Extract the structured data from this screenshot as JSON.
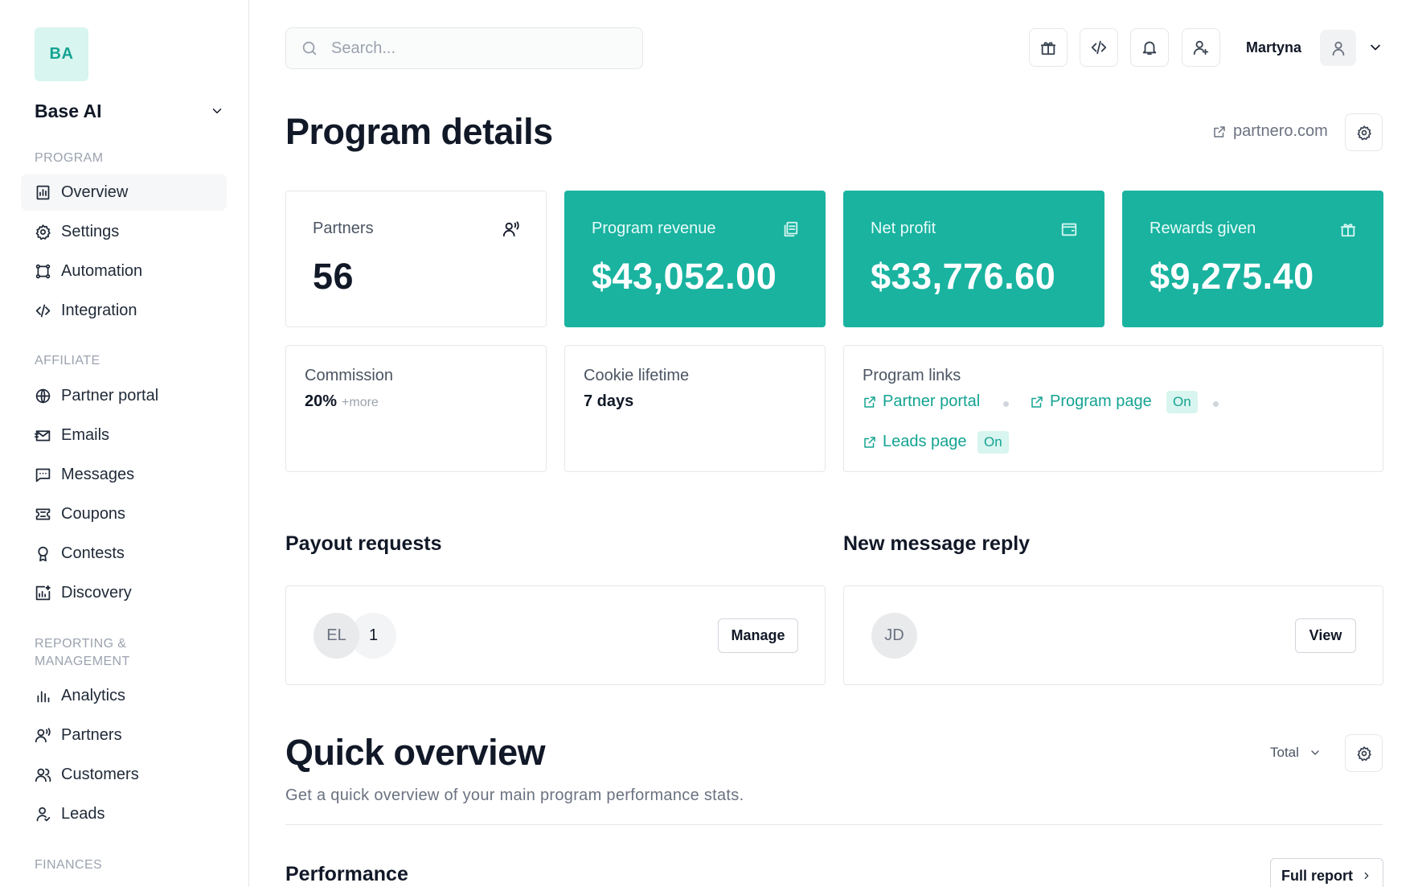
{
  "sidebar": {
    "logo_initials": "BA",
    "workspace_name": "Base AI",
    "sections": {
      "program": "PROGRAM",
      "affiliate": "AFFILIATE",
      "reporting_line1": "REPORTING &",
      "reporting_line2": "MANAGEMENT",
      "finances": "FINANCES"
    },
    "items": {
      "overview": "Overview",
      "settings": "Settings",
      "automation": "Automation",
      "integration": "Integration",
      "partner_portal": "Partner portal",
      "emails": "Emails",
      "messages": "Messages",
      "coupons": "Coupons",
      "contests": "Contests",
      "discovery": "Discovery",
      "analytics": "Analytics",
      "partners": "Partners",
      "customers": "Customers",
      "leads": "Leads"
    },
    "active_item": "Overview"
  },
  "header": {
    "search_placeholder": "Search...",
    "user_name": "Martyna",
    "icons": [
      "gift-icon",
      "code-icon",
      "bell-icon",
      "user-plus-icon",
      "user-icon",
      "chevron-down-icon"
    ]
  },
  "page": {
    "title": "Program details",
    "site_link": "partnero.com"
  },
  "stats": {
    "partners": {
      "label": "Partners",
      "value": "56"
    },
    "revenue": {
      "label": "Program revenue",
      "value": "$43,052.00"
    },
    "net_profit": {
      "label": "Net profit",
      "value": "$33,776.60"
    },
    "rewards": {
      "label": "Rewards given",
      "value": "$9,275.40"
    }
  },
  "info": {
    "commission": {
      "label": "Commission",
      "value": "20%",
      "more": "+more"
    },
    "cookie": {
      "label": "Cookie lifetime",
      "value": "7 days"
    },
    "links": {
      "label": "Program links",
      "partner_portal": "Partner portal",
      "program_page": "Program page",
      "program_page_status": "On",
      "leads_page": "Leads page",
      "leads_page_status": "On"
    }
  },
  "payout": {
    "title": "Payout requests",
    "avatar_initials": "EL",
    "count": "1",
    "button": "Manage"
  },
  "message": {
    "title": "New message reply",
    "avatar_initials": "JD",
    "button": "View"
  },
  "quick_overview": {
    "title": "Quick overview",
    "subtitle": "Get a quick overview of your main program performance stats.",
    "period": "Total",
    "performance_title": "Performance",
    "full_report": "Full report"
  },
  "colors": {
    "accent": "#19b3a0",
    "accent_light": "#d8f5ef",
    "accent_text": "#14a392"
  }
}
